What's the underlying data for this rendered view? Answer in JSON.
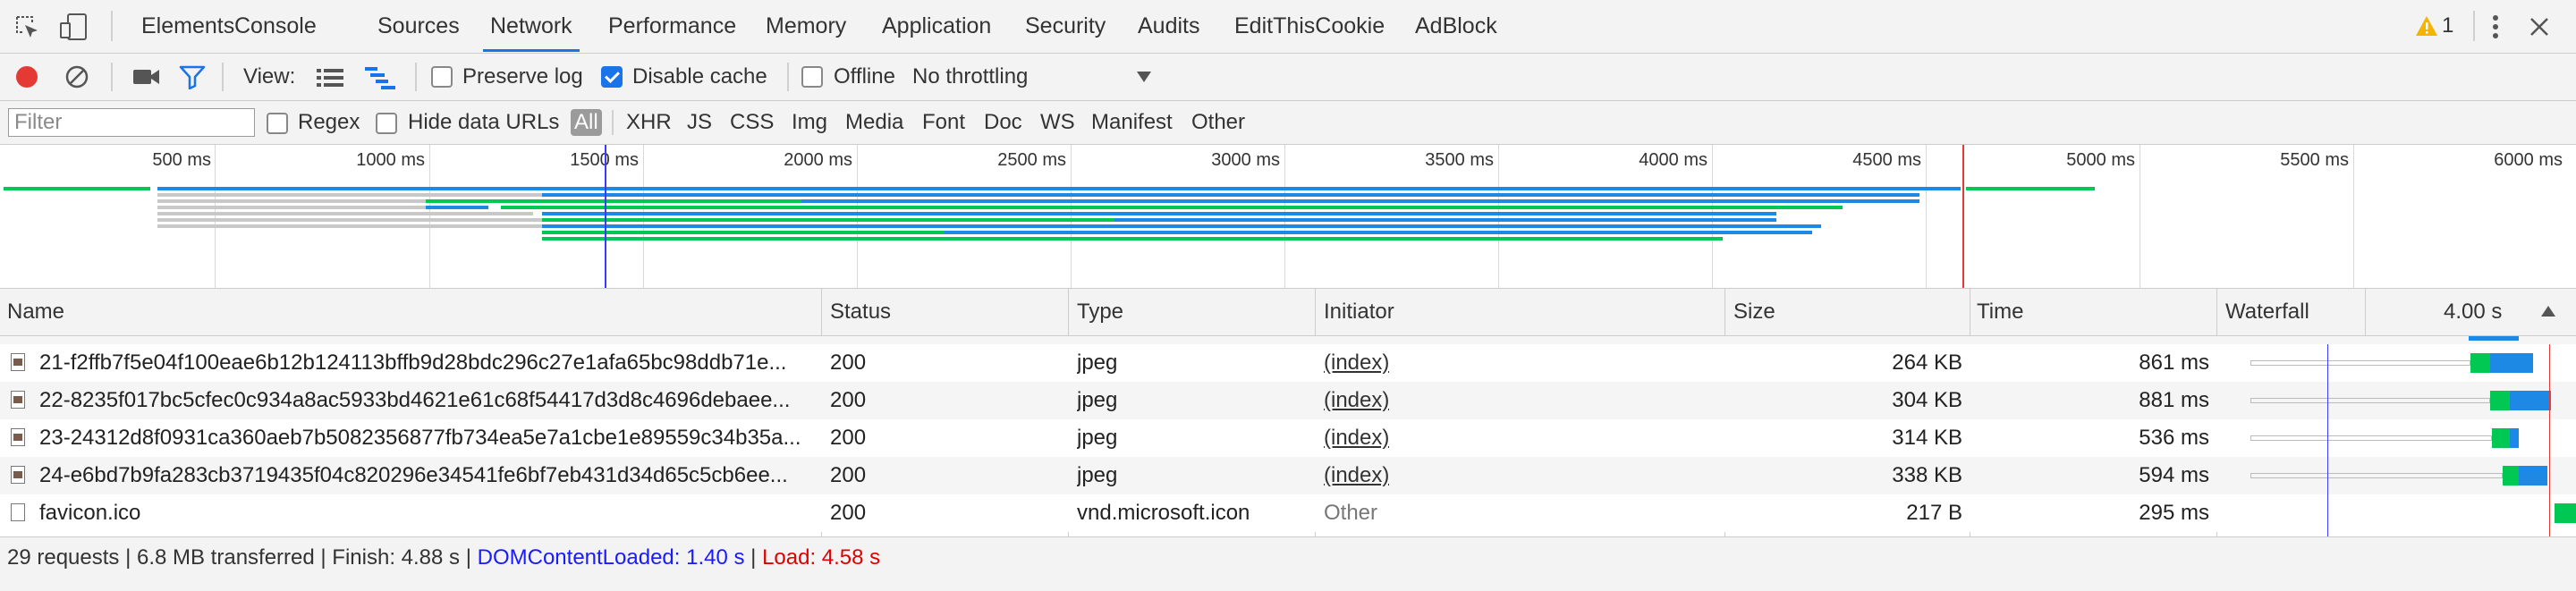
{
  "tabs": [
    "Elements",
    "Console",
    "Sources",
    "Network",
    "Performance",
    "Memory",
    "Application",
    "Security",
    "Audits",
    "EditThisCookie",
    "AdBlock"
  ],
  "active_tab": "Network",
  "header_right": {
    "warning_count": "1"
  },
  "toolbar": {
    "view_label": "View:",
    "preserve_log": {
      "label": "Preserve log",
      "checked": false
    },
    "disable_cache": {
      "label": "Disable cache",
      "checked": true
    },
    "offline": {
      "label": "Offline",
      "checked": false
    },
    "throttling": "No throttling"
  },
  "filterbar": {
    "placeholder": "Filter",
    "regex_label": "Regex",
    "hide_data_urls_label": "Hide data URLs",
    "types": [
      "All",
      "XHR",
      "JS",
      "CSS",
      "Img",
      "Media",
      "Font",
      "Doc",
      "WS",
      "Manifest",
      "Other"
    ],
    "active_type": "All"
  },
  "overview": {
    "ticks": [
      "500 ms",
      "1000 ms",
      "1500 ms",
      "2000 ms",
      "2500 ms",
      "3000 ms",
      "3500 ms",
      "4000 ms",
      "4500 ms",
      "5000 ms",
      "5500 ms",
      "6000 ms"
    ],
    "dom_content_loaded_ms": 1400,
    "load_ms": 4580,
    "colors": {
      "waiting": "#00c853",
      "receiving": "#1e88e5",
      "queued": "#c8c8c8",
      "dcl": "#3b3bff",
      "load": "#e53935"
    }
  },
  "table": {
    "columns": [
      "Name",
      "Status",
      "Type",
      "Initiator",
      "Size",
      "Time",
      "Waterfall"
    ],
    "waterfall_scale": "4.00 s",
    "rows": [
      {
        "name": "21-f2ffb7f5e04f100eae6b12b124113bffb9d28bdc296c27e1afa65bc98ddb71e...",
        "status": "200",
        "type": "jpeg",
        "initiator": "(index)",
        "size": "264 KB",
        "time": "861 ms",
        "icon": "image-file-icon"
      },
      {
        "name": "22-8235f017bc5cfec0c934a8ac5933bd4621e61c68f54417d3d8c4696debaee...",
        "status": "200",
        "type": "jpeg",
        "initiator": "(index)",
        "size": "304 KB",
        "time": "881 ms",
        "icon": "image-file-icon"
      },
      {
        "name": "23-24312d8f0931ca360aeb7b5082356877fb734ea5e7a1cbe1e89559c34b35a...",
        "status": "200",
        "type": "jpeg",
        "initiator": "(index)",
        "size": "314 KB",
        "time": "536 ms",
        "icon": "image-file-icon"
      },
      {
        "name": "24-e6bd7b9fa283cb3719435f04c820296e34541fe6bf7eb431d34d65c5cb6ee...",
        "status": "200",
        "type": "jpeg",
        "initiator": "(index)",
        "size": "338 KB",
        "time": "594 ms",
        "icon": "image-file-icon"
      },
      {
        "name": "favicon.ico",
        "status": "200",
        "type": "vnd.microsoft.icon",
        "initiator": "Other",
        "size": "217 B",
        "time": "295 ms",
        "icon": "blank-file-icon"
      }
    ]
  },
  "status": {
    "summary": "29 requests | 6.8 MB transferred | Finish: 4.88 s |",
    "dom_content_loaded": "DOMContentLoaded: 1.40 s",
    "load": "Load: 4.58 s",
    "dcl_color": "#1a1aff",
    "load_color": "#e00000"
  }
}
